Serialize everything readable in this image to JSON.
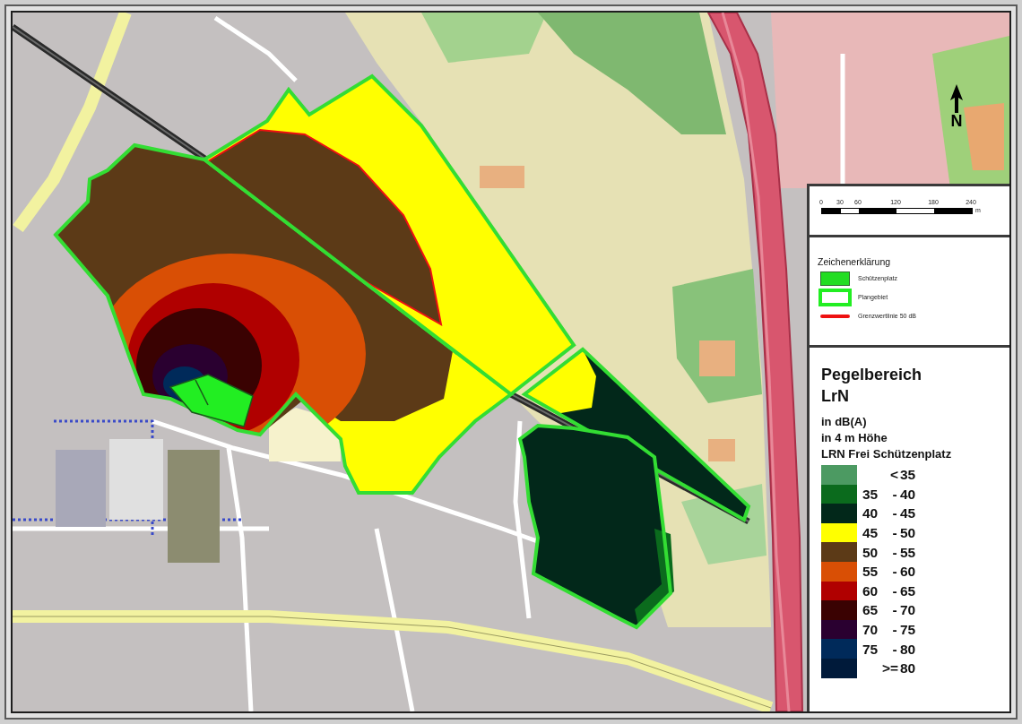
{
  "map": {
    "north_arrow": {
      "label": "N"
    }
  },
  "scale_bar": {
    "ticks": [
      "0",
      "30",
      "60",
      "120",
      "180",
      "240"
    ],
    "unit": "m"
  },
  "legend": {
    "title": "Zeichenerklärung",
    "items": [
      {
        "kind": "fill",
        "label": "Schützenplatz",
        "color": "#22dd22"
      },
      {
        "kind": "outline",
        "label": "Plangebiet",
        "color": "#22ee22"
      },
      {
        "kind": "line",
        "label": "Grenzwertlinie 50 dB",
        "color": "#ee1111"
      }
    ]
  },
  "levels": {
    "title_lines": [
      "Pegelbereich",
      "LrN"
    ],
    "subtitle_lines": [
      "in dB(A)",
      "in 4 m Höhe",
      "LRN Frei Schützenplatz"
    ],
    "ranges": [
      {
        "kind": "bound",
        "operator": "<",
        "value": "35",
        "color": "#4c9a62"
      },
      {
        "kind": "range",
        "low": "35",
        "separator": "-",
        "high": "40",
        "color": "#0b6b1d"
      },
      {
        "kind": "range",
        "low": "40",
        "separator": "-",
        "high": "45",
        "color": "#02281a"
      },
      {
        "kind": "range",
        "low": "45",
        "separator": "-",
        "high": "50",
        "color": "#ffff00"
      },
      {
        "kind": "range",
        "low": "50",
        "separator": "-",
        "high": "55",
        "color": "#5c3a17"
      },
      {
        "kind": "range",
        "low": "55",
        "separator": "-",
        "high": "60",
        "color": "#d94f05"
      },
      {
        "kind": "range",
        "low": "60",
        "separator": "-",
        "high": "65",
        "color": "#b00000"
      },
      {
        "kind": "range",
        "low": "65",
        "separator": "-",
        "high": "70",
        "color": "#3a0202"
      },
      {
        "kind": "range",
        "low": "70",
        "separator": "-",
        "high": "75",
        "color": "#2a0030"
      },
      {
        "kind": "range",
        "low": "75",
        "separator": "-",
        "high": "80",
        "color": "#002a5a"
      },
      {
        "kind": "bound",
        "operator": ">=",
        "value": "80",
        "color": "#001a3a"
      }
    ]
  }
}
